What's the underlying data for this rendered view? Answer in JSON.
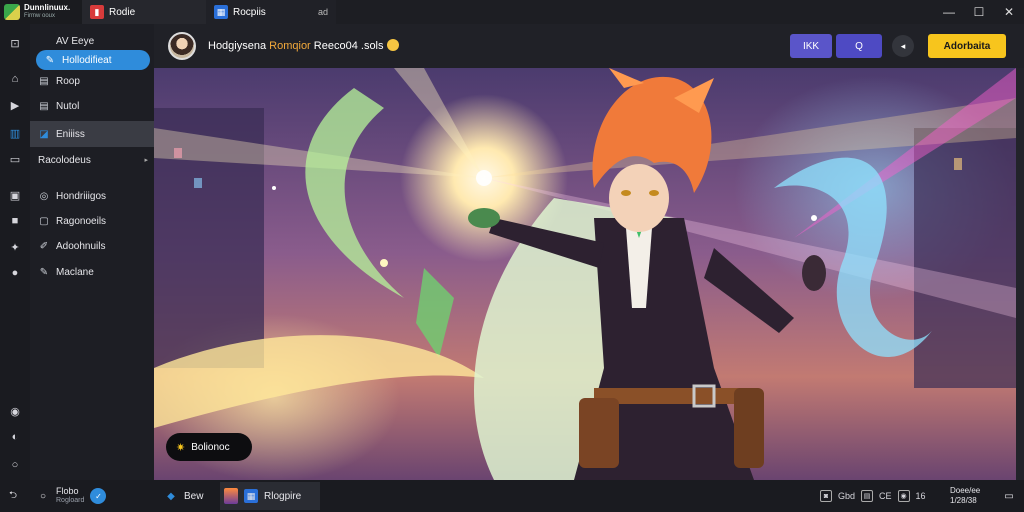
{
  "titlebar": {
    "brand_title": "Dunnlinuux.",
    "brand_sub": "Firmw ooux",
    "tabs": [
      {
        "label": "Rodie",
        "icon": "red-app-icon"
      },
      {
        "label": "Rocpiis",
        "close": "ad"
      }
    ],
    "window_controls": [
      "—",
      "☐",
      "✕"
    ]
  },
  "sidebar": {
    "items": [
      {
        "label": "AV Eeye",
        "icon": "ai-icon"
      },
      {
        "label": "Hollodifieat",
        "icon": "edit-icon",
        "state": "highlight"
      },
      {
        "label": "Roop",
        "icon": "home-icon"
      },
      {
        "label": "Nutol",
        "icon": "play-icon"
      },
      {
        "label": "Eniiiss",
        "icon": "grid-icon",
        "state": "active"
      },
      {
        "label": "Racolodeus",
        "icon": "folder-icon",
        "caret": "▸"
      },
      {
        "label": "Hondriiigos",
        "icon": "chat-icon"
      },
      {
        "label": "Ragonoeils",
        "icon": "message-icon"
      },
      {
        "label": "Adoohnuils",
        "icon": "pen-icon"
      },
      {
        "label": "Maclane",
        "icon": "pencil-icon"
      }
    ]
  },
  "header": {
    "username": "Hodgiysena",
    "username_hl": "Romqior",
    "status": "Reeco04 .sols",
    "btn1": "IKK",
    "btn2": "Q",
    "circle_btn": "◂",
    "cta": "Adorbaita"
  },
  "main": {
    "badge_label": "Bolionoc",
    "badge_icon": "sparkle-icon"
  },
  "taskbar": {
    "user_name": "Flobo",
    "user_sub": "Rogloard",
    "app1": "Bew",
    "app2": "Rlogpire",
    "tray": [
      "Gbd",
      "CE",
      "16"
    ],
    "clock_line1": "Doee/ee",
    "clock_line2": "1/28/38"
  },
  "colors": {
    "accent_blue": "#2f8cdb",
    "accent_yellow": "#f7c51d",
    "purple_button": "#5a55c9",
    "bg_dark": "#17181c"
  }
}
